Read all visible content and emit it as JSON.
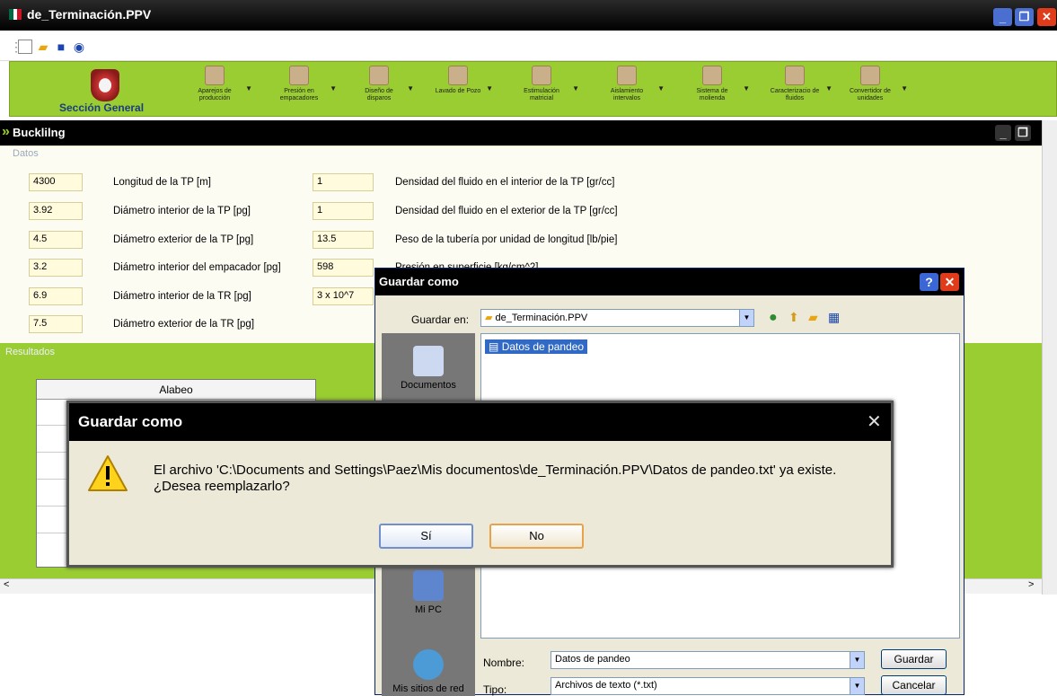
{
  "main_window": {
    "title": "de_Terminación.PPV"
  },
  "ribbon": {
    "seccion": "Sección General",
    "items": [
      {
        "label": "Aparejos de producción"
      },
      {
        "label": "Presión en empacadores"
      },
      {
        "label": "Diseño de disparos"
      },
      {
        "label": "Lavado de Pozo"
      },
      {
        "label": "Estimulación matricial"
      },
      {
        "label": "Aislamiento intervalos"
      },
      {
        "label": "Sistema de molienda"
      },
      {
        "label": "Caracterizacio de fluidos"
      },
      {
        "label": "Convertidor de unidades"
      }
    ]
  },
  "child_window": {
    "title": "Bucklilng"
  },
  "datos": {
    "legend": "Datos",
    "left": [
      {
        "value": "4300",
        "label": "Longitud de la TP [m]"
      },
      {
        "value": "3.92",
        "label": "Diámetro interior de la TP [pg]"
      },
      {
        "value": "4.5",
        "label": "Diámetro exterior de la TP [pg]"
      },
      {
        "value": "3.2",
        "label": "Diámetro interior del empacador [pg]"
      },
      {
        "value": "6.9",
        "label": "Diámetro interior de la TR [pg]"
      },
      {
        "value": "7.5",
        "label": "Diámetro exterior de la TR [pg]"
      }
    ],
    "right": [
      {
        "value": "1",
        "label": "Densidad del fluido en el interior de la TP [gr/cc]"
      },
      {
        "value": "1",
        "label": "Densidad del fluido en el exterior de la TP [gr/cc]"
      },
      {
        "value": "13.5",
        "label": "Peso de la tubería por unidad de longitud [lb/pie]"
      },
      {
        "value": "598",
        "label": "Presión en superficie [kg/cm^2]"
      },
      {
        "value": "3 x 10^7",
        "label": ""
      }
    ]
  },
  "resultados": {
    "legend": "Resultados",
    "header": "Alabeo"
  },
  "save_dialog": {
    "title": "Guardar como",
    "help": "?",
    "save_in_label": "Guardar en:",
    "save_in_value": "de_Terminación.PPV",
    "places": [
      {
        "label": "Documentos"
      },
      {
        "label": "Mi PC"
      },
      {
        "label": "Mis sitios de red"
      }
    ],
    "files": [
      "Datos de pandeo"
    ],
    "name_label": "Nombre:",
    "name_value": "Datos de pandeo",
    "type_label": "Tipo:",
    "type_value": "Archivos de texto (*.txt)",
    "save_button": "Guardar",
    "cancel_button": "Cancelar"
  },
  "confirm_dialog": {
    "title": "Guardar como",
    "message_line1": "El archivo 'C:\\Documents and Settings\\Paez\\Mis documentos\\de_Terminación.PPV\\Datos de pandeo.txt' ya existe.",
    "message_line2": "¿Desea reemplazarlo?",
    "yes_button": "Sí",
    "no_button": "No"
  },
  "colors": {
    "ribbon": "#9acd32",
    "titlebar": "#000000",
    "close": "#e03c1c"
  }
}
